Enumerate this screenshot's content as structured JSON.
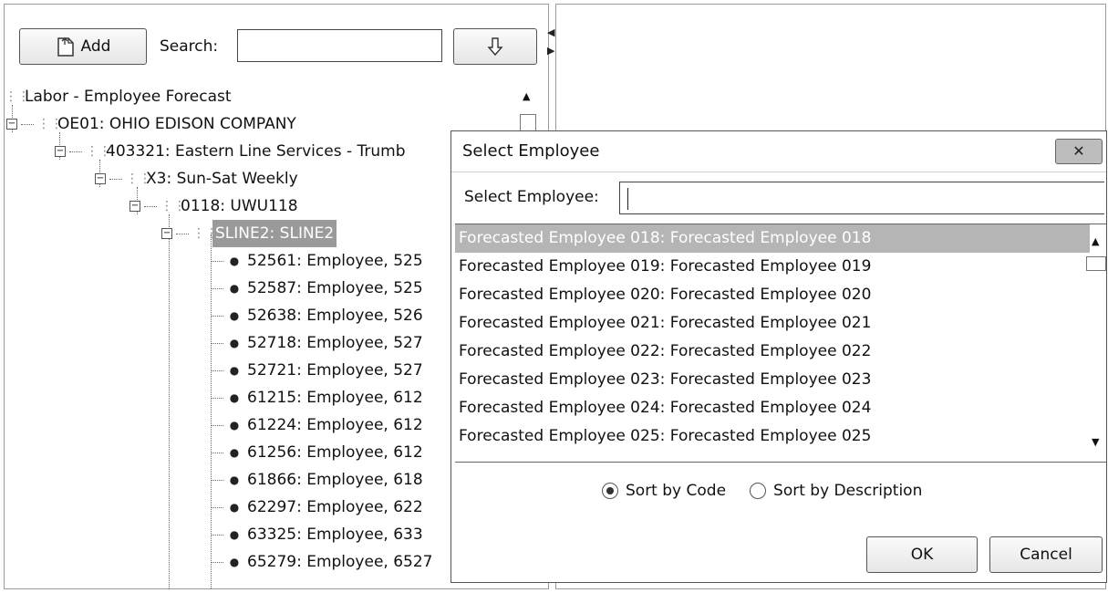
{
  "toolbar": {
    "add_label": "Add",
    "search_label": "Search:",
    "search_value": ""
  },
  "tree": {
    "root": "Labor - Employee Forecast",
    "company": "OE01: OHIO EDISON COMPANY",
    "department": "403321: Eastern Line Services - Trumb",
    "schedule": "X3: Sun-Sat Weekly",
    "unit": "0118: UWU118",
    "line": "SLINE2: SLINE2",
    "employees": [
      "52561: Employee, 525",
      "52587: Employee, 525",
      "52638: Employee, 526",
      "52718: Employee, 527",
      "52721: Employee, 527",
      "61215: Employee, 612",
      "61224: Employee, 612",
      "61256: Employee, 612",
      "61866: Employee, 618",
      "62297: Employee, 622",
      "63325: Employee, 633",
      "65279: Employee, 6527"
    ]
  },
  "dialog": {
    "title": "Select Employee",
    "close_label": "✕",
    "select_label": "Select Employee:",
    "select_value": "",
    "employees": [
      "Forecasted Employee 018: Forecasted Employee 018",
      "Forecasted Employee 019: Forecasted Employee 019",
      "Forecasted Employee 020: Forecasted Employee 020",
      "Forecasted Employee 021: Forecasted Employee 021",
      "Forecasted Employee 022: Forecasted Employee 022",
      "Forecasted Employee 023: Forecasted Employee 023",
      "Forecasted Employee 024: Forecasted Employee 024",
      "Forecasted Employee 025: Forecasted Employee 025"
    ],
    "selected_index": 0,
    "sort_by_code": "Sort by Code",
    "sort_by_description": "Sort by Description",
    "sort_selected": "code",
    "ok_label": "OK",
    "cancel_label": "Cancel"
  }
}
